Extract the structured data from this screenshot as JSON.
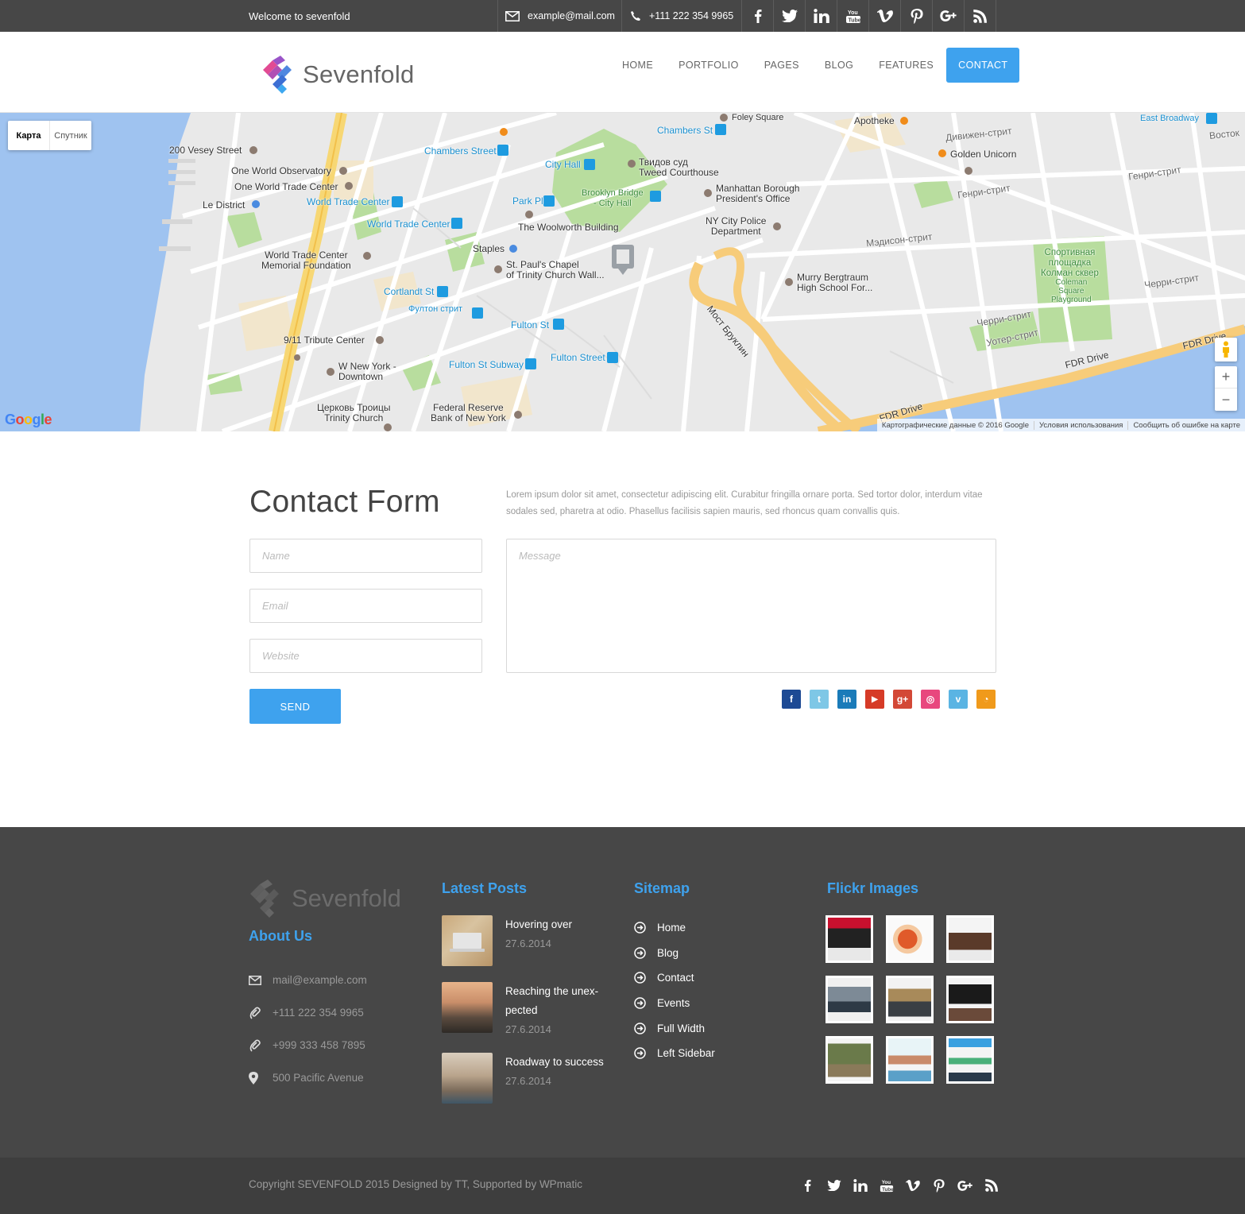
{
  "topbar": {
    "welcome": "Welcome to sevenfold",
    "email": "example@mail.com",
    "phone": "+111 222 354 9965",
    "social": [
      "facebook-icon",
      "twitter-icon",
      "linkedin-icon",
      "youtube-icon",
      "vimeo-icon",
      "pinterest-icon",
      "googleplus-icon",
      "rss-icon"
    ]
  },
  "header": {
    "logo_text": "Sevenfold",
    "nav": [
      "HOME",
      "PORTFOLIO",
      "PAGES",
      "BLOG",
      "FEATURES",
      "CONTACT"
    ],
    "active_nav": "CONTACT"
  },
  "map": {
    "type_map": "Карта",
    "type_satellite": "Спутник",
    "labels": {
      "vesey": "200 Vesey Street",
      "observatory": "One World Observatory",
      "owtc": "One World Trade Center",
      "le_district": "Le District",
      "wtc_blue": "World Trade Center",
      "wtc_blue2": "World Trade Center",
      "memorial": "World Trade Center\nMemorial Foundation",
      "chambers": "Chambers Street",
      "chambers2": "Chambers St",
      "city_hall": "City Hall",
      "park_pl": "Park Pl",
      "woolworth": "The Woolworth Building",
      "staples": "Staples",
      "st_pauls": "St. Paul's Chapel\nof Trinity Church Wall...",
      "cortlandt": "Cortlandt St",
      "fulton_ru": "Фултон стрит",
      "fulton_st": "Fulton St",
      "fulton_street": "Fulton Street",
      "fulton_subway": "Fulton St Subway",
      "tribute": "9/11 Tribute Center",
      "w_ny": "W New York -\nDowntown",
      "trinity": "Церковь Троицы\nTrinity Church",
      "fed": "Federal Reserve\nBank of New York",
      "tweed": "Твидов суд\nTweed Courthouse",
      "brooklyn_bridge": "Brooklyn Bridge\n- City Hall",
      "manhattan_borough": "Manhattan Borough\nPresident's Office",
      "nypd": "NY City Police\nDepartment",
      "murry": "Murry Bergtraum\nHigh School For...",
      "foley": "Foley Square",
      "apotheke": "Apotheke",
      "golden_unicorn": "Golden Unicorn",
      "east_broadway": "East Broadway",
      "brooklyn_bridge_ru": "Мост Бруклин",
      "fdr": "FDR Drive",
      "fdr2": "FDR Drive",
      "fdr3": "FDR Drive",
      "coleman": "Спортивная\nплощадка\nКолман сквер",
      "coleman_en": "Coleman\nSquare\nPlayground",
      "henry1": "Генри-стрит",
      "henry2": "Генри-стрит",
      "cherry1": "Черри-стрит",
      "cherry2": "Черри-стрит",
      "madison": "Мэдисон-стрит",
      "division": "Дивижен-стрит",
      "water": "Уотер-стрит",
      "vostok": "Восток"
    },
    "footer": [
      "Картографические данные © 2016 Google",
      "Условия использования",
      "Сообщить об ошибке на карте"
    ],
    "google": "Google"
  },
  "contact": {
    "title": "Contact Form",
    "intro": "Lorem ipsum dolor sit amet, consectetur adipiscing elit. Curabitur fringilla ornare porta. Sed tortor dolor, interdum vitae sodales sed, pharetra at odio. Phasellus facilisis sapien mauris, sed rhoncus quam convallis quis.",
    "name_placeholder": "Name",
    "email_placeholder": "Email",
    "website_placeholder": "Website",
    "message_placeholder": "Message",
    "send_label": "SEND",
    "social": [
      {
        "name": "facebook-icon",
        "glyph": "f",
        "color": "#1d4a94"
      },
      {
        "name": "twitter-icon",
        "glyph": "t",
        "color": "#7ec7e6"
      },
      {
        "name": "linkedin-icon",
        "glyph": "in",
        "color": "#1a7bb9"
      },
      {
        "name": "youtube-icon",
        "glyph": "▶",
        "color": "#d63b27"
      },
      {
        "name": "googleplus-icon",
        "glyph": "g+",
        "color": "#d34836"
      },
      {
        "name": "dribbble-icon",
        "glyph": "◎",
        "color": "#e8477e"
      },
      {
        "name": "vimeo-icon",
        "glyph": "v",
        "color": "#5ab4e3"
      },
      {
        "name": "rss-icon",
        "glyph": "◔",
        "color": "#f09a1b"
      }
    ]
  },
  "footer": {
    "logo_text": "Sevenfold",
    "about_heading": "About Us",
    "about": [
      {
        "icon": "mail-icon",
        "text": "mail@example.com"
      },
      {
        "icon": "phone-icon",
        "text": "+111 222 354 9965"
      },
      {
        "icon": "phone-icon",
        "text": "+999 333 458 7895"
      },
      {
        "icon": "location-icon",
        "text": "500 Pacific Avenue"
      }
    ],
    "posts_heading": "Latest Posts",
    "posts": [
      {
        "title": "Hovering over",
        "date": "27.6.2014"
      },
      {
        "title": "Reaching the unex-pected",
        "date": "27.6.2014"
      },
      {
        "title": "Roadway to success",
        "date": "27.6.2014"
      }
    ],
    "sitemap_heading": "Sitemap",
    "sitemap": [
      "Home",
      "Blog",
      "Contact",
      "Events",
      "Full Width",
      "Left Sidebar"
    ],
    "flickr_heading": "Flickr Images",
    "copyright": "Copyright SEVENFOLD 2015 Designed by TT, Supported by WPmatic"
  }
}
